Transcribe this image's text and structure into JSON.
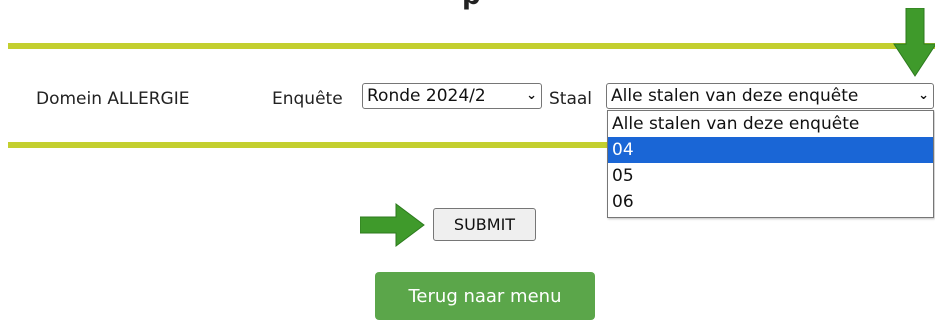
{
  "page": {
    "cut_title_fragment": "p"
  },
  "form": {
    "domain_label": "Domein ALLERGIE",
    "enquete_label": "Enquête",
    "enquete_value": "Ronde 2024/2",
    "staal_label": "Staal",
    "staal_value": "Alle stalen van deze enquête",
    "staal_options": [
      "Alle stalen van deze enquête",
      "04",
      "05",
      "06"
    ],
    "staal_highlighted": "04",
    "submit_label": "SUBMIT"
  },
  "nav": {
    "back_label": "Terug naar menu"
  },
  "colors": {
    "rule": "#c3cf2f",
    "arrow": "#3f9a2b",
    "menu_button": "#5ba64a",
    "highlight": "#1a66d6"
  },
  "icons": {
    "dropdown_caret": "chevron-down-icon",
    "annotation_arrow": "green-arrow-icon"
  }
}
